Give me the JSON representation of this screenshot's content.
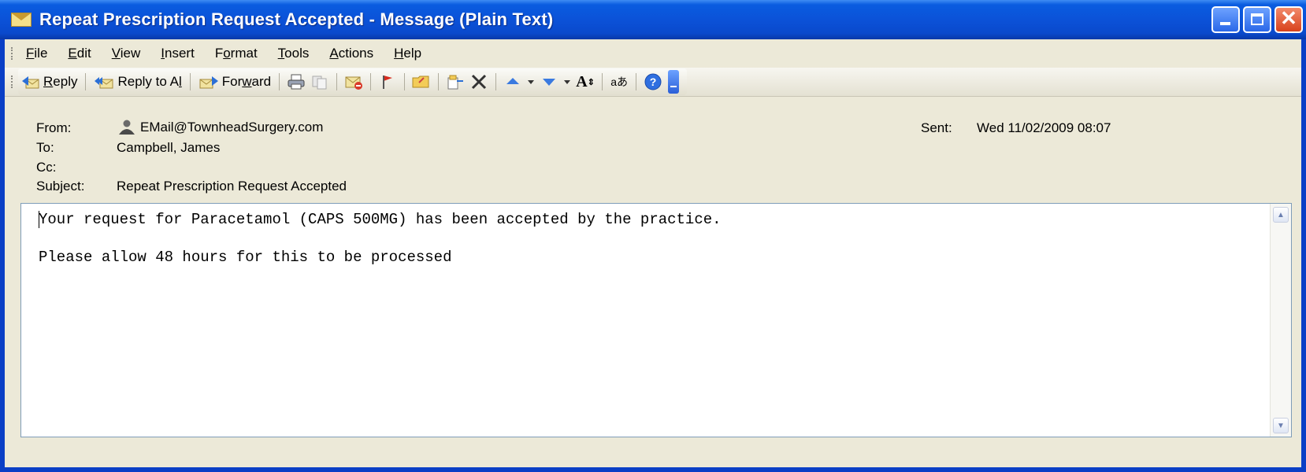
{
  "window": {
    "title": "Repeat Prescription Request Accepted - Message (Plain Text)",
    "title_icon": "envelope-icon",
    "close_glyph": "✕"
  },
  "menu": {
    "items": [
      {
        "label": "File",
        "u": "F",
        "rest": "ile"
      },
      {
        "label": "Edit",
        "u": "E",
        "rest": "dit"
      },
      {
        "label": "View",
        "u": "V",
        "rest": "iew"
      },
      {
        "label": "Insert",
        "u": "I",
        "rest": "nsert"
      },
      {
        "label": "Format",
        "pre": "F",
        "u": "o",
        "rest": "rmat"
      },
      {
        "label": "Tools",
        "u": "T",
        "rest": "ools"
      },
      {
        "label": "Actions",
        "u": "A",
        "rest": "ctions"
      },
      {
        "label": "Help",
        "u": "H",
        "rest": "elp"
      }
    ]
  },
  "toolbar": {
    "reply_pre": "",
    "reply_u": "R",
    "reply_rest": "eply",
    "reply_all_pre": "Reply to A",
    "reply_all_u": "l",
    "reply_all_rest": "l",
    "forward_pre": "For",
    "forward_u": "w",
    "forward_rest": "ard",
    "font_size_label": "A",
    "translate_label": "a"
  },
  "header": {
    "from_label": "From:",
    "from_value": "EMail@TownheadSurgery.com",
    "to_label": "To:",
    "to_value": "Campbell, James",
    "cc_label": "Cc:",
    "cc_value": "",
    "subject_label": "Subject:",
    "subject_value": "Repeat Prescription Request Accepted",
    "sent_label": "Sent:",
    "sent_value": "Wed 11/02/2009 08:07"
  },
  "message": {
    "line1": "Your request for Paracetamol (CAPS 500MG) has been accepted by the practice.",
    "line2": "",
    "line3": "Please allow 48 hours for this to be processed"
  },
  "colors": {
    "titlebar": "#0b52d8",
    "chrome": "#ece9d8",
    "close_button": "#d8421c"
  }
}
